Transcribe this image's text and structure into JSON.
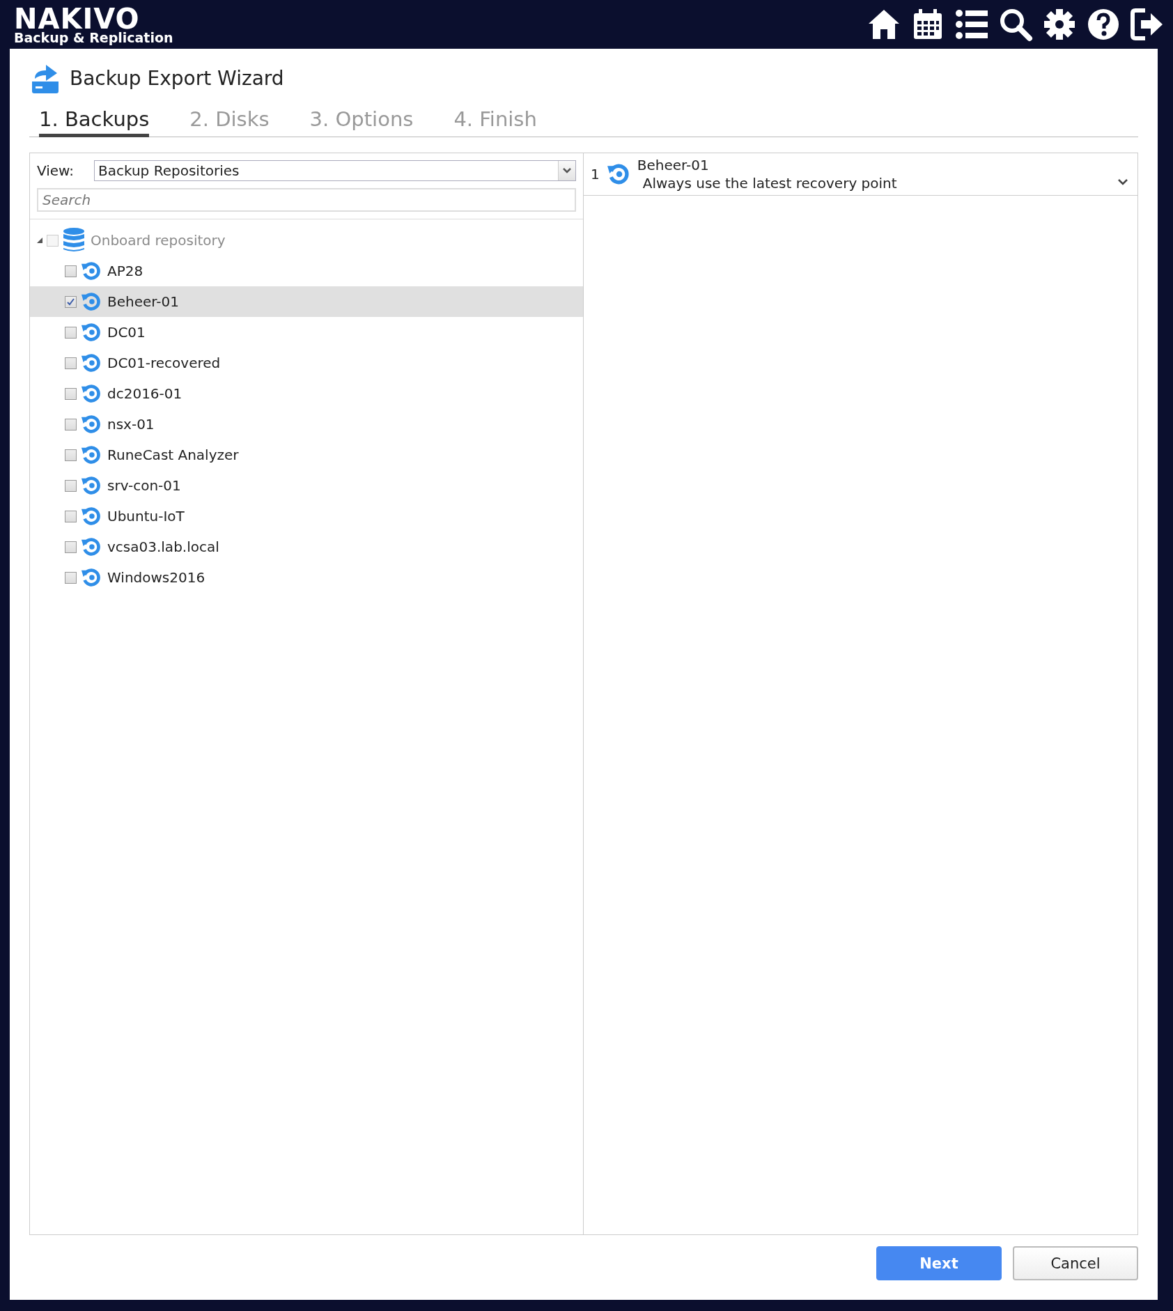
{
  "header": {
    "logo": "NAKIVO",
    "logo_subtitle": "Backup & Replication"
  },
  "wizard": {
    "title": "Backup Export Wizard",
    "tabs": [
      {
        "label": "1. Backups",
        "selected": true
      },
      {
        "label": "2. Disks",
        "selected": false
      },
      {
        "label": "3. Options",
        "selected": false
      },
      {
        "label": "4. Finish",
        "selected": false
      }
    ],
    "view": {
      "label": "View:",
      "value": "Backup Repositories"
    },
    "search": {
      "placeholder": "Search"
    },
    "tree": {
      "label": "Onboard repository",
      "expanded": true,
      "checked": false,
      "children": [
        {
          "label": "AP28",
          "checked": false,
          "selected": false
        },
        {
          "label": "Beheer-01",
          "checked": true,
          "selected": true
        },
        {
          "label": "DC01",
          "checked": false,
          "selected": false
        },
        {
          "label": "DC01-recovered",
          "checked": false,
          "selected": false
        },
        {
          "label": "dc2016-01",
          "checked": false,
          "selected": false
        },
        {
          "label": "nsx-01",
          "checked": false,
          "selected": false
        },
        {
          "label": "RuneCast Analyzer",
          "checked": false,
          "selected": false
        },
        {
          "label": "srv-con-01",
          "checked": false,
          "selected": false
        },
        {
          "label": "Ubuntu-IoT",
          "checked": false,
          "selected": false
        },
        {
          "label": "vcsa03.lab.local",
          "checked": false,
          "selected": false
        },
        {
          "label": "Windows2016",
          "checked": false,
          "selected": false
        }
      ]
    },
    "selected_backups": [
      {
        "index": "1",
        "name": "Beheer-01",
        "recovery_point": "Always use the latest recovery point"
      }
    ],
    "buttons": [
      {
        "label": "Next",
        "kind": "primary"
      },
      {
        "label": "Cancel",
        "kind": "secondary"
      }
    ]
  }
}
